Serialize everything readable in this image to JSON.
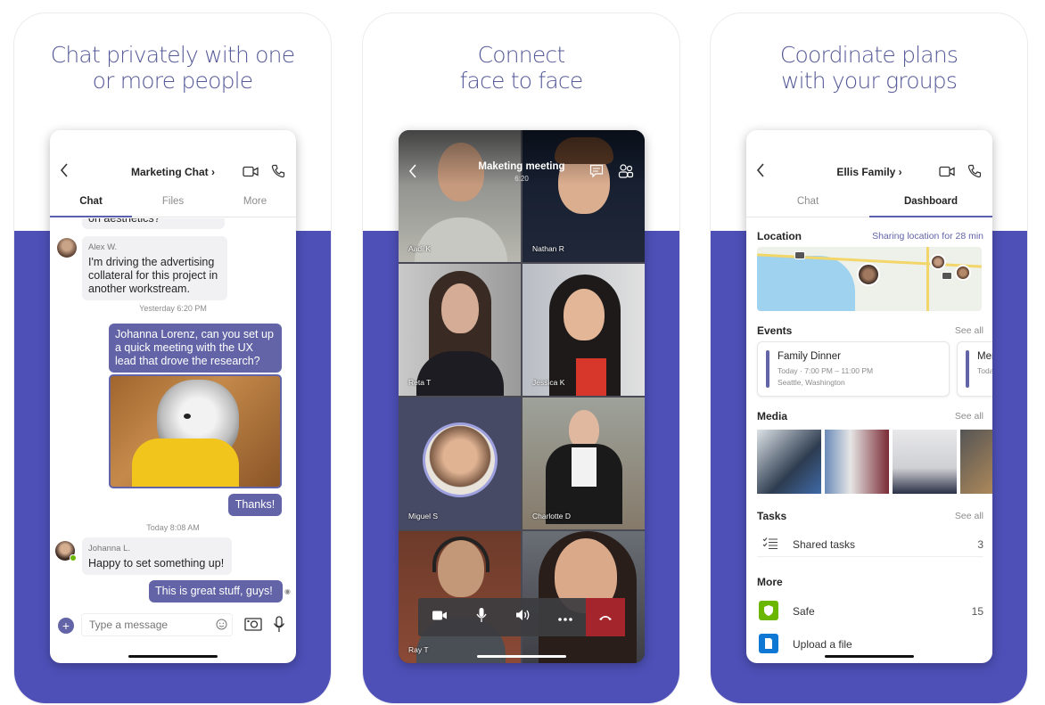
{
  "panels": [
    {
      "headline": [
        "Chat privately with one",
        "or more people"
      ],
      "phone": {
        "header": {
          "title": "Marketing Chat ›",
          "back_icon": "chevron-left",
          "video_icon": "video-camera",
          "call_icon": "phone"
        },
        "tabs": [
          {
            "label": "Chat",
            "active": true
          },
          {
            "label": "Files",
            "active": false
          },
          {
            "label": "More",
            "active": false
          }
        ],
        "messages": [
          {
            "type": "in",
            "text": "on aesthetics?",
            "partial": true
          },
          {
            "type": "in",
            "sender": "Alex W.",
            "lines": [
              "I'm driving the advertising",
              "collateral for this project in",
              "another workstream."
            ]
          },
          {
            "type": "timestamp",
            "text": "Yesterday 6:20 PM"
          },
          {
            "type": "out",
            "lines": [
              "Johanna Lorenz, can you set up",
              "a quick meeting with the UX",
              "lead that drove the research?"
            ]
          },
          {
            "type": "out-image",
            "alt": "Dog in yellow raincoat"
          },
          {
            "type": "out",
            "text": "Thanks!"
          },
          {
            "type": "timestamp",
            "text": "Today 8:08 AM"
          },
          {
            "type": "in",
            "sender": "Johanna L.",
            "text": "Happy to set something up!"
          },
          {
            "type": "out",
            "text": "This is great stuff, guys!",
            "read_receipt": "eye"
          }
        ],
        "compose": {
          "placeholder": "Type a message",
          "add_icon": "plus",
          "emoji_icon": "smiley",
          "camera_icon": "camera",
          "mic_icon": "microphone"
        }
      }
    },
    {
      "headline": [
        "Connect",
        "face to face"
      ],
      "phone": {
        "header": {
          "title": "Maketing meeting",
          "duration": "6:20",
          "back_icon": "chevron-left",
          "chat_icon": "chat-bubble",
          "participants_icon": "people"
        },
        "participants": [
          "Aadi K",
          "Nathan R",
          "Reta T",
          "Jessica K",
          "Miguel S",
          "Charlotte D",
          "Ray T",
          ""
        ],
        "controls": [
          "video-camera",
          "microphone",
          "speaker",
          "more",
          "hang-up"
        ]
      }
    },
    {
      "headline": [
        "Coordinate plans",
        "with your groups"
      ],
      "phone": {
        "header": {
          "title": "Ellis Family ›",
          "back_icon": "chevron-left",
          "video_icon": "video-camera",
          "call_icon": "phone"
        },
        "tabs": [
          {
            "label": "Chat",
            "active": false
          },
          {
            "label": "Dashboard",
            "active": true
          }
        ],
        "location": {
          "title": "Location",
          "status": "Sharing location for 28 min"
        },
        "events": {
          "title": "Events",
          "see_all": "See all",
          "items": [
            {
              "title": "Family Dinner",
              "time": "Today · 7:00 PM – 11:00 PM",
              "place": "Seattle, Washington"
            },
            {
              "title": "Mer",
              "time": "Toda"
            }
          ]
        },
        "media": {
          "title": "Media",
          "see_all": "See all",
          "count_visible": 4
        },
        "tasks": {
          "title": "Tasks",
          "see_all": "See all",
          "items": [
            {
              "label": "Shared tasks",
              "count": "3"
            }
          ]
        },
        "more": {
          "title": "More",
          "items": [
            {
              "label": "Safe",
              "count": "15",
              "color": "#6bb700"
            },
            {
              "label": "Upload a file",
              "color": "#0f78d4"
            }
          ]
        }
      }
    }
  ],
  "colors": {
    "brand": "#4e50b8",
    "accent": "#6264a7",
    "headline": "#565a98",
    "hangup": "#a4262c"
  }
}
